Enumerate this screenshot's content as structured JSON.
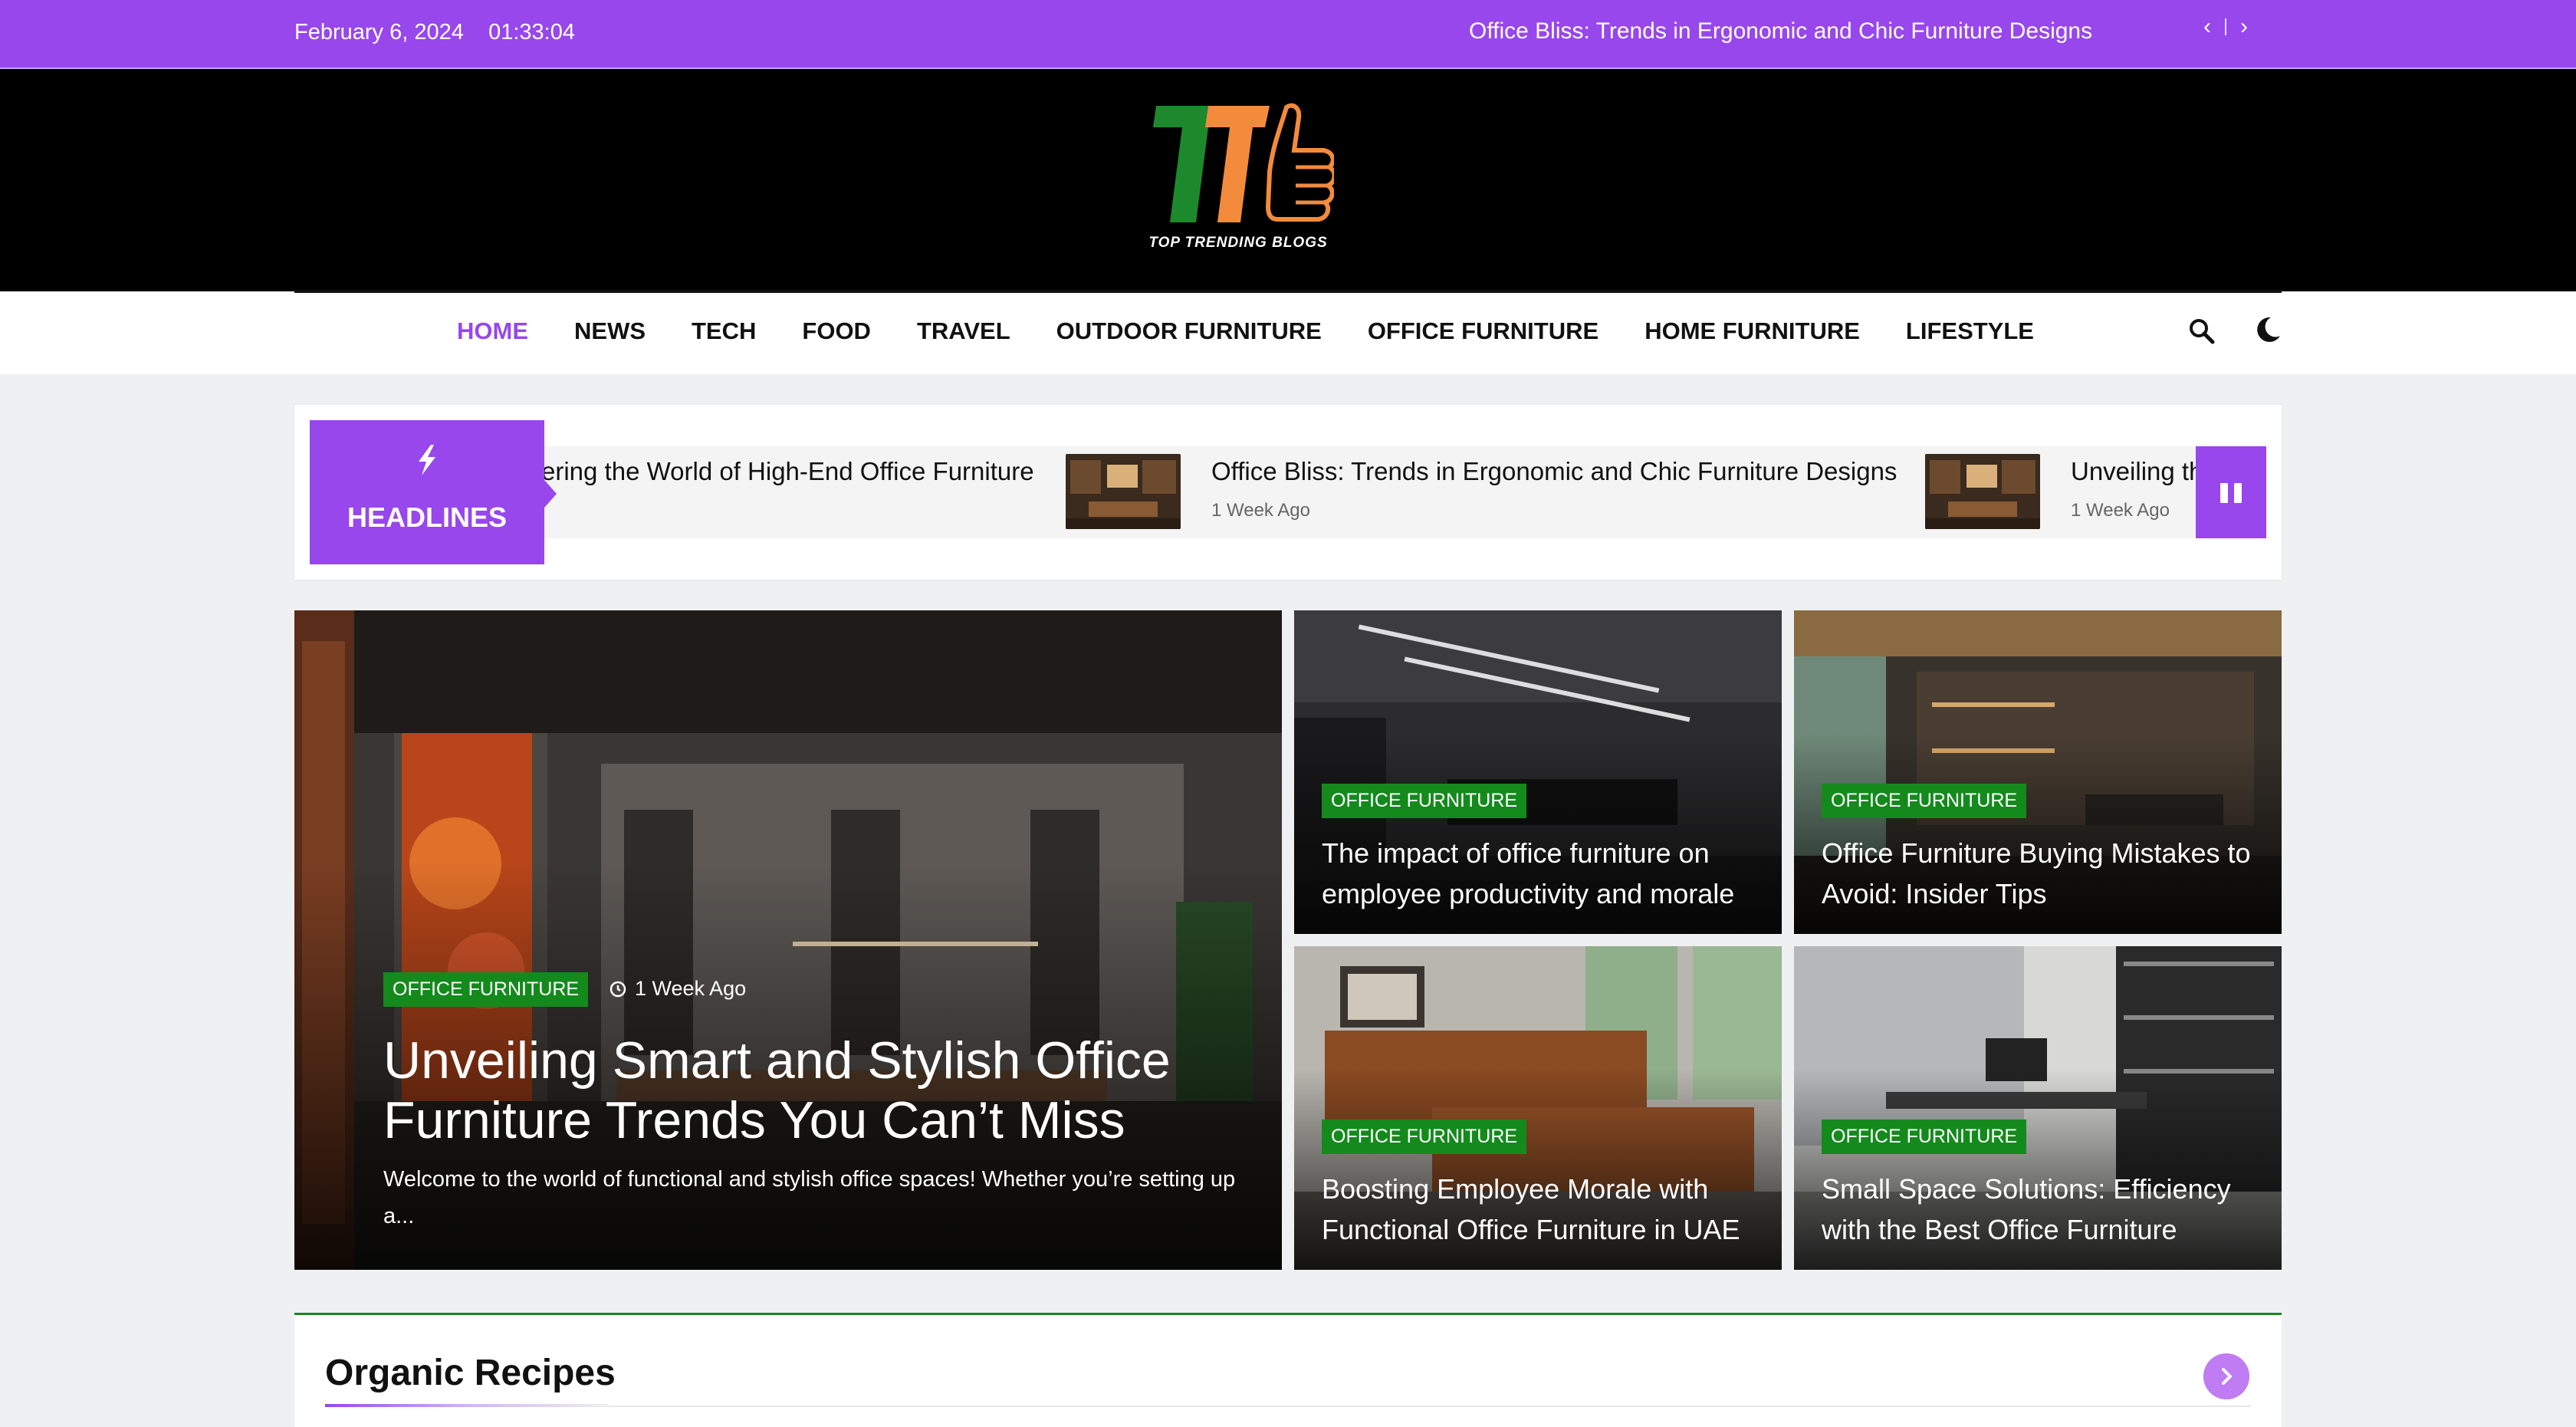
{
  "topbar": {
    "date": "February 6, 2024",
    "time": "01:33:04",
    "ticker": "Office Bliss: Trends in Ergonomic and Chic Furniture Designs",
    "prev_icon": "chevron-left-icon",
    "next_icon": "chevron-right-icon"
  },
  "brand": {
    "logo_text": "TOP TRENDING BLOGS",
    "logo_colors": {
      "t1": "#1c8a2c",
      "t2": "#f28b3c",
      "thumb": "#f28b3c"
    }
  },
  "nav": {
    "items": [
      {
        "label": "HOME",
        "active": true
      },
      {
        "label": "NEWS",
        "active": false
      },
      {
        "label": "TECH",
        "active": false
      },
      {
        "label": "FOOD",
        "active": false
      },
      {
        "label": "TRAVEL",
        "active": false
      },
      {
        "label": "OUTDOOR FURNITURE",
        "active": false
      },
      {
        "label": "OFFICE FURNITURE",
        "active": false
      },
      {
        "label": "HOME FURNITURE",
        "active": false
      },
      {
        "label": "LIFESTYLE",
        "active": false
      }
    ],
    "search_icon": "search-icon",
    "theme_icon": "moon-icon"
  },
  "headlines": {
    "label": "HEADLINES",
    "icon": "bolt-icon",
    "items": [
      {
        "title": "ering the World of High-End Office Furniture",
        "time": ""
      },
      {
        "title": "Office Bliss: Trends in Ergonomic and Chic Furniture Designs",
        "time": "1 Week Ago"
      },
      {
        "title": "Unveiling th",
        "time": "1 Week Ago"
      }
    ],
    "pause_icon": "pause-icon"
  },
  "featured": {
    "main": {
      "category": "OFFICE FURNITURE",
      "time": "1 Week Ago",
      "title_line1": "Unveiling Smart and Stylish Office",
      "title_line2": "Furniture Trends You Can’t Miss",
      "excerpt_line1": "Welcome to the world of functional and stylish office spaces! Whether you’re setting up",
      "excerpt_line2": "a..."
    },
    "tiles": [
      {
        "category": "OFFICE FURNITURE",
        "line1": "The impact of office furniture on",
        "line2": "employee productivity and morale"
      },
      {
        "category": "OFFICE FURNITURE",
        "line1": "Office Furniture Buying Mistakes to",
        "line2": "Avoid: Insider Tips"
      },
      {
        "category": "OFFICE FURNITURE",
        "line1": "Boosting Employee Morale with",
        "line2": "Functional Office Furniture in UAE"
      },
      {
        "category": "OFFICE FURNITURE",
        "line1": "Small Space Solutions: Efficiency",
        "line2": "with the Best Office Furniture"
      }
    ]
  },
  "section": {
    "title": "Organic Recipes",
    "next_icon": "chevron-right-icon"
  },
  "colors": {
    "accent": "#9747ec",
    "badge": "#148a1d",
    "header_bg": "#000000"
  }
}
